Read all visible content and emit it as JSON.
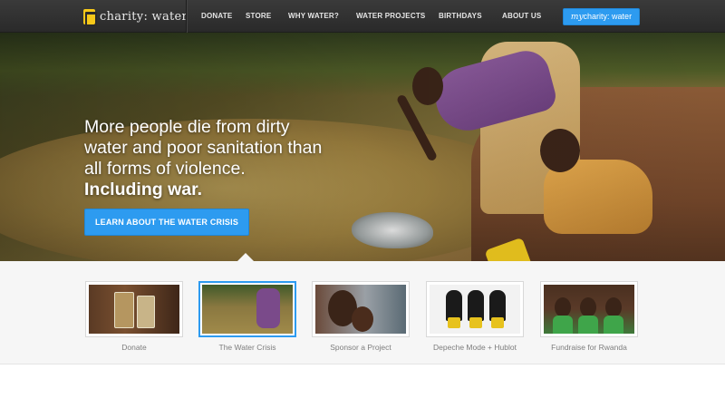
{
  "nav": {
    "brand": "charity: water",
    "links": [
      "DONATE",
      "STORE",
      "WHY WATER?",
      "WATER PROJECTS",
      "BIRTHDAYS",
      "ABOUT US"
    ],
    "account_button": {
      "prefix": "my",
      "suffix": "charity: water"
    }
  },
  "hero": {
    "headline_lines": [
      "More people die from dirty",
      "water and poor sanitation than",
      "all forms of violence."
    ],
    "headline_strong": "Including war.",
    "cta": "LEARN ABOUT THE WATER CRISIS"
  },
  "thumbnails": [
    {
      "label": "Donate",
      "active": false
    },
    {
      "label": "The Water Crisis",
      "active": true
    },
    {
      "label": "Sponsor a Project",
      "active": false
    },
    {
      "label": "Depeche Mode + Hublot",
      "active": false
    },
    {
      "label": "Fundraise for Rwanda",
      "active": false
    }
  ],
  "colors": {
    "accent": "#2d9bf0",
    "nav_bg": "#333333",
    "logo_yellow": "#f6c819"
  }
}
